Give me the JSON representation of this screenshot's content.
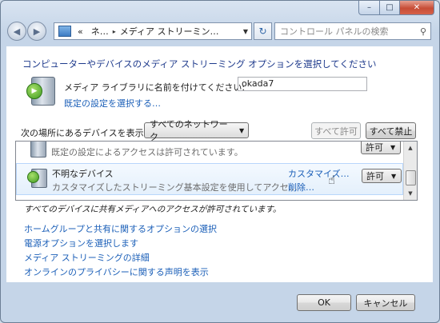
{
  "window": {
    "min_glyph": "–",
    "max_glyph": "□",
    "close_glyph": "✕"
  },
  "nav": {
    "back_glyph": "◀",
    "forward_glyph": "▶",
    "breadcrumbs": [
      "«",
      "ネ…",
      "メディア ストリーミン…"
    ],
    "refresh_glyph": "↻",
    "search_placeholder": "コントロール パネルの検索",
    "search_icon": "search-icon"
  },
  "main": {
    "heading": "コンピューターやデバイスのメディア ストリーミング オプションを選択してください",
    "library": {
      "label": "メディア ライブラリに名前を付けてください:",
      "value": "okada7",
      "default_link": "既定の設定を選択する…"
    },
    "filter": {
      "label": "次の場所にあるデバイスを表示:",
      "selected": "すべてのネットワーク",
      "allow_all": "すべて許可",
      "block_all": "すべて禁止"
    },
    "devices": [
      {
        "name": "",
        "description": "既定の設定によるアクセスは許可されています。",
        "permission": "許可"
      },
      {
        "name": "不明なデバイス",
        "description": "カスタマイズしたストリーミング基本設定を使用してアクセ…",
        "customize": "カスタマイズ…",
        "remove": "削除…",
        "permission": "許可"
      }
    ],
    "shared_note": "すべてのデバイスに共有メディアへのアクセスが許可されています。",
    "links": [
      "ホームグループと共有に関するオプションの選択",
      "電源オプションを選択します",
      "メディア ストリーミングの詳細",
      "オンラインのプライバシーに関する声明を表示"
    ]
  },
  "footer": {
    "ok": "OK",
    "cancel": "キャンセル"
  },
  "colors": {
    "link": "#1b5fb8",
    "heading": "#1e3a8c",
    "frame": "#c5d5e8"
  }
}
